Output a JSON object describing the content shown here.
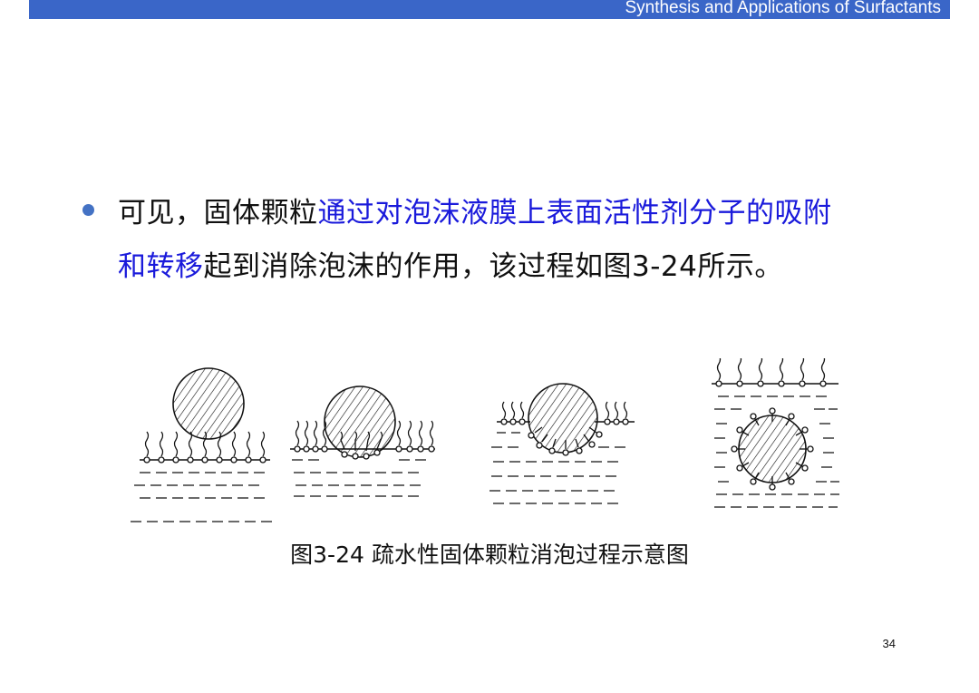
{
  "header": {
    "title": "Synthesis and Applications of Surfactants",
    "bar_color": "#3a66c8"
  },
  "content": {
    "bullet_color": "#4472c4",
    "highlight_color": "#1a1adb",
    "line1_a": "可见，固体颗粒",
    "line1_b": "通过对泡沫液膜上表面活性剂分子的吸附",
    "line2_a": "和转移",
    "line2_b": "起到消除泡沫的作用，该过程如图3-24所示。"
  },
  "figure": {
    "caption": "图3-24 疏水性固体颗粒消泡过程示意图"
  },
  "footer": {
    "page_number": "34"
  }
}
